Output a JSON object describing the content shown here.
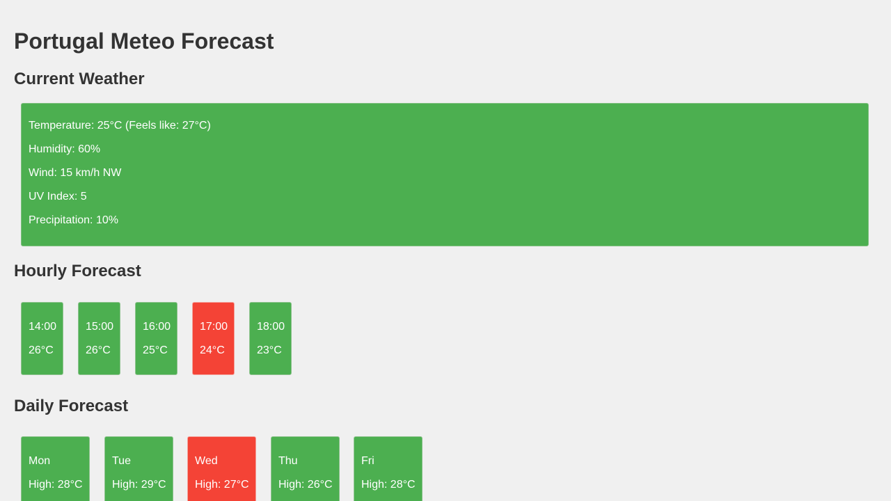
{
  "page": {
    "title": "Portugal Meteo Forecast"
  },
  "sections": {
    "current": "Current Weather",
    "hourly": "Hourly Forecast",
    "daily": "Daily Forecast"
  },
  "current": {
    "temperature": "Temperature: 25°C (Feels like: 27°C)",
    "humidity": "Humidity: 60%",
    "wind": "Wind: 15 km/h NW",
    "uv": "UV Index: 5",
    "precipitation": "Precipitation: 10%"
  },
  "hourly": [
    {
      "time": "14:00",
      "temp": "26°C",
      "status": "green"
    },
    {
      "time": "15:00",
      "temp": "26°C",
      "status": "green"
    },
    {
      "time": "16:00",
      "temp": "25°C",
      "status": "green"
    },
    {
      "time": "17:00",
      "temp": "24°C",
      "status": "red"
    },
    {
      "time": "18:00",
      "temp": "23°C",
      "status": "green"
    }
  ],
  "daily": [
    {
      "day": "Mon",
      "high": "High: 28°C",
      "status": "green"
    },
    {
      "day": "Tue",
      "high": "High: 29°C",
      "status": "green"
    },
    {
      "day": "Wed",
      "high": "High: 27°C",
      "status": "red"
    },
    {
      "day": "Thu",
      "high": "High: 26°C",
      "status": "green"
    },
    {
      "day": "Fri",
      "high": "High: 28°C",
      "status": "green"
    }
  ],
  "colors": {
    "background": "#f0f0f0",
    "card_green": "#4caf50",
    "card_red": "#f44336",
    "text_dark": "#333333",
    "text_light": "#ffffff"
  }
}
